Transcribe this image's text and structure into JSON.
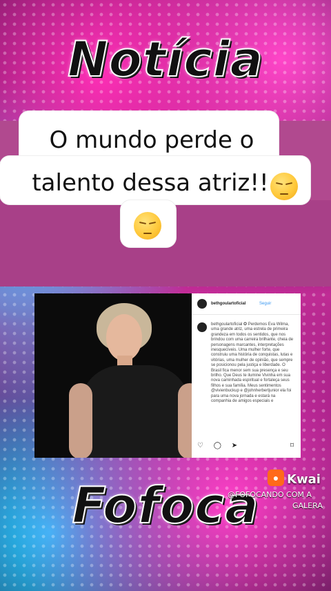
{
  "header": {
    "title": "Notícia"
  },
  "caption": {
    "line1": "O mundo perde o",
    "line2": "talento dessa atriz!!"
  },
  "emojis": [
    "pensive-face",
    "pensive-face"
  ],
  "post": {
    "username": "bethgoulartoficial",
    "follow_label": "Seguir",
    "text": "bethgoulartoficial ✪ Perdemos Eva Wilma, uma grande atriz, uma estrela de primeira grandeza em todos os sentidos, que nos brindou com uma carreira brilhante, cheia de personagens marcantes, interpretações inesquecíveis. Uma mulher forte, que construiu uma história de conquistas, lutas e vitórias, uma mulher de opinião, que sempre se posicionou pela justiça e liberdade. O Brasil fica menor sem sua presença e seu brilho. Que Deus te ilumine Vivinha em sua nova caminhada espiritual e fortaleça seus filhos e sua família. Meus sentimentos @vivienbuckup e @johnherbertjunior ela foi para uma nova jornada e estará na companhia de amigos especiais e"
  },
  "footer": {
    "title": "Fofoca"
  },
  "watermark": {
    "brand": "Kwai",
    "handle_line1": "@FOFOCANDO COM A",
    "handle_line2": "GALERA"
  }
}
